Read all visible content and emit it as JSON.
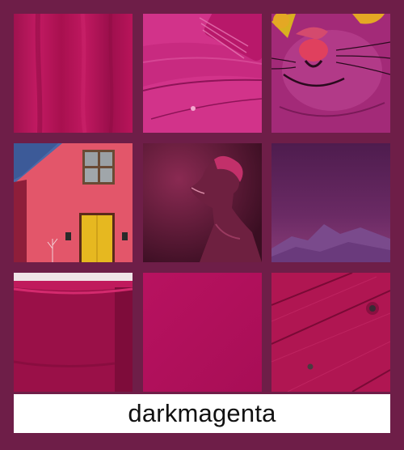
{
  "label": "darkmagenta",
  "colors": {
    "background": "#6e1e48",
    "swatch": "#b0105a",
    "label_bg": "#ffffff",
    "label_text": "#111111"
  },
  "tiles": [
    {
      "subject": "fabric"
    },
    {
      "subject": "paint-brush"
    },
    {
      "subject": "cat-face"
    },
    {
      "subject": "house"
    },
    {
      "subject": "portrait"
    },
    {
      "subject": "mountain-sky"
    },
    {
      "subject": "bowl"
    },
    {
      "subject": "solid-swatch"
    },
    {
      "subject": "wood-plank"
    }
  ]
}
